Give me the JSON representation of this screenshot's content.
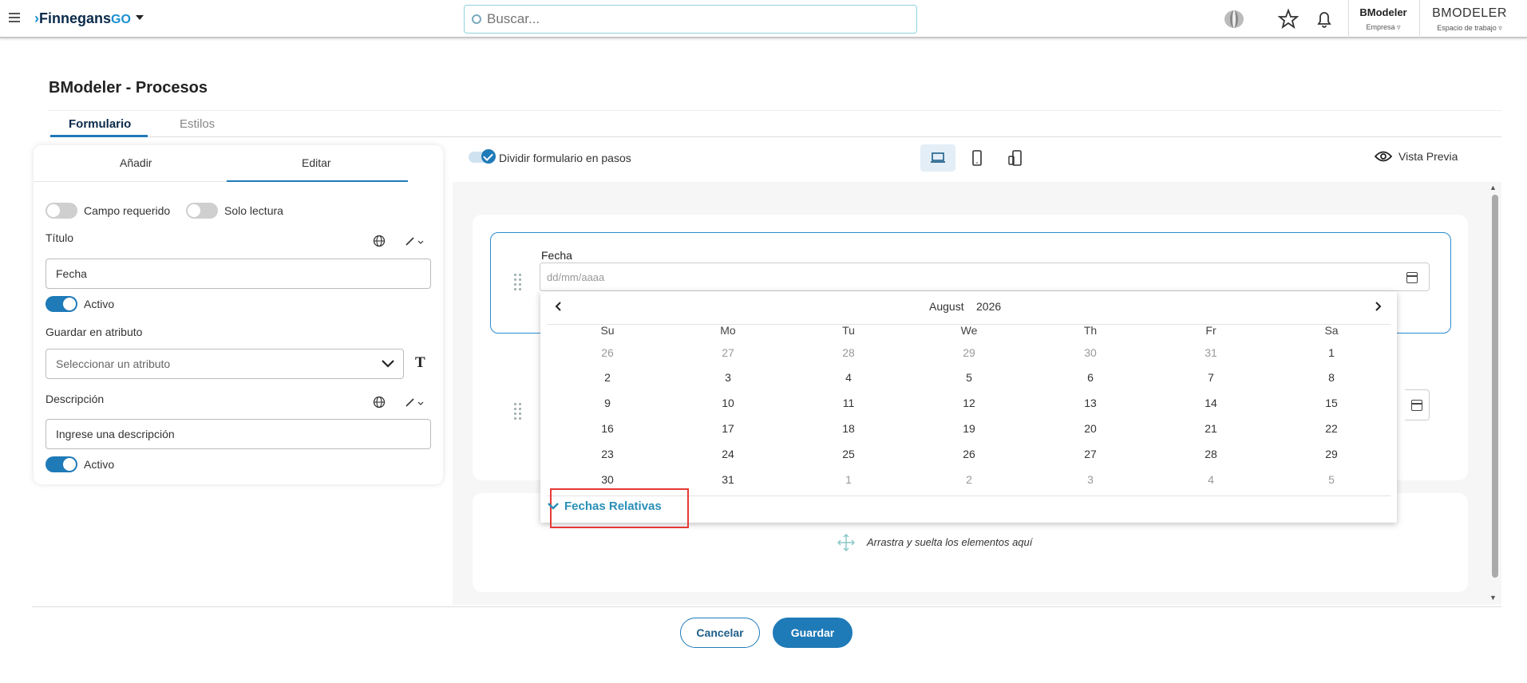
{
  "topbar": {
    "logo_main": "Finnegans",
    "logo_go": "GO",
    "search_placeholder": "Buscar...",
    "org1_name": "BModeler",
    "org1_sub": "Empresa",
    "org2_name": "BMODELER",
    "org2_sub": "Espacio de trabajo"
  },
  "page": {
    "title": "BModeler - Procesos",
    "tabs": [
      "Formulario",
      "Estilos"
    ]
  },
  "left_panel": {
    "tabs": [
      "Añadir",
      "Editar"
    ],
    "required_label": "Campo requerido",
    "readonly_label": "Solo lectura",
    "title_label": "Título",
    "title_value": "Fecha",
    "active_label": "Activo",
    "attr_label": "Guardar en atributo",
    "attr_placeholder": "Seleccionar un atributo",
    "desc_label": "Descripción",
    "desc_placeholder": "Ingrese una descripción",
    "active_label2": "Activo"
  },
  "toolbar": {
    "steps_label": "Dividir formulario en pasos",
    "preview_label": "Vista Previa"
  },
  "form": {
    "field_label": "Fecha",
    "date_placeholder": "dd/mm/aaaa",
    "dropzone_text": "Arrastra y suelta los elementos aquí"
  },
  "calendar": {
    "month": "August",
    "year": "2026",
    "weekdays": [
      "Su",
      "Mo",
      "Tu",
      "We",
      "Th",
      "Fr",
      "Sa"
    ],
    "weeks": [
      [
        "26",
        "27",
        "28",
        "29",
        "30",
        "31",
        "1"
      ],
      [
        "2",
        "3",
        "4",
        "5",
        "6",
        "7",
        "8"
      ],
      [
        "9",
        "10",
        "11",
        "12",
        "13",
        "14",
        "15"
      ],
      [
        "16",
        "17",
        "18",
        "19",
        "20",
        "21",
        "22"
      ],
      [
        "23",
        "24",
        "25",
        "26",
        "27",
        "28",
        "29"
      ],
      [
        "30",
        "31",
        "1",
        "2",
        "3",
        "4",
        "5"
      ]
    ],
    "relative_label": "Fechas Relativas"
  },
  "footer": {
    "cancel_label": "Cancelar",
    "save_label": "Guardar"
  },
  "colors": {
    "accent": "#1f7ab8",
    "highlight_box": "#e53935",
    "link": "#2a8fb8"
  }
}
